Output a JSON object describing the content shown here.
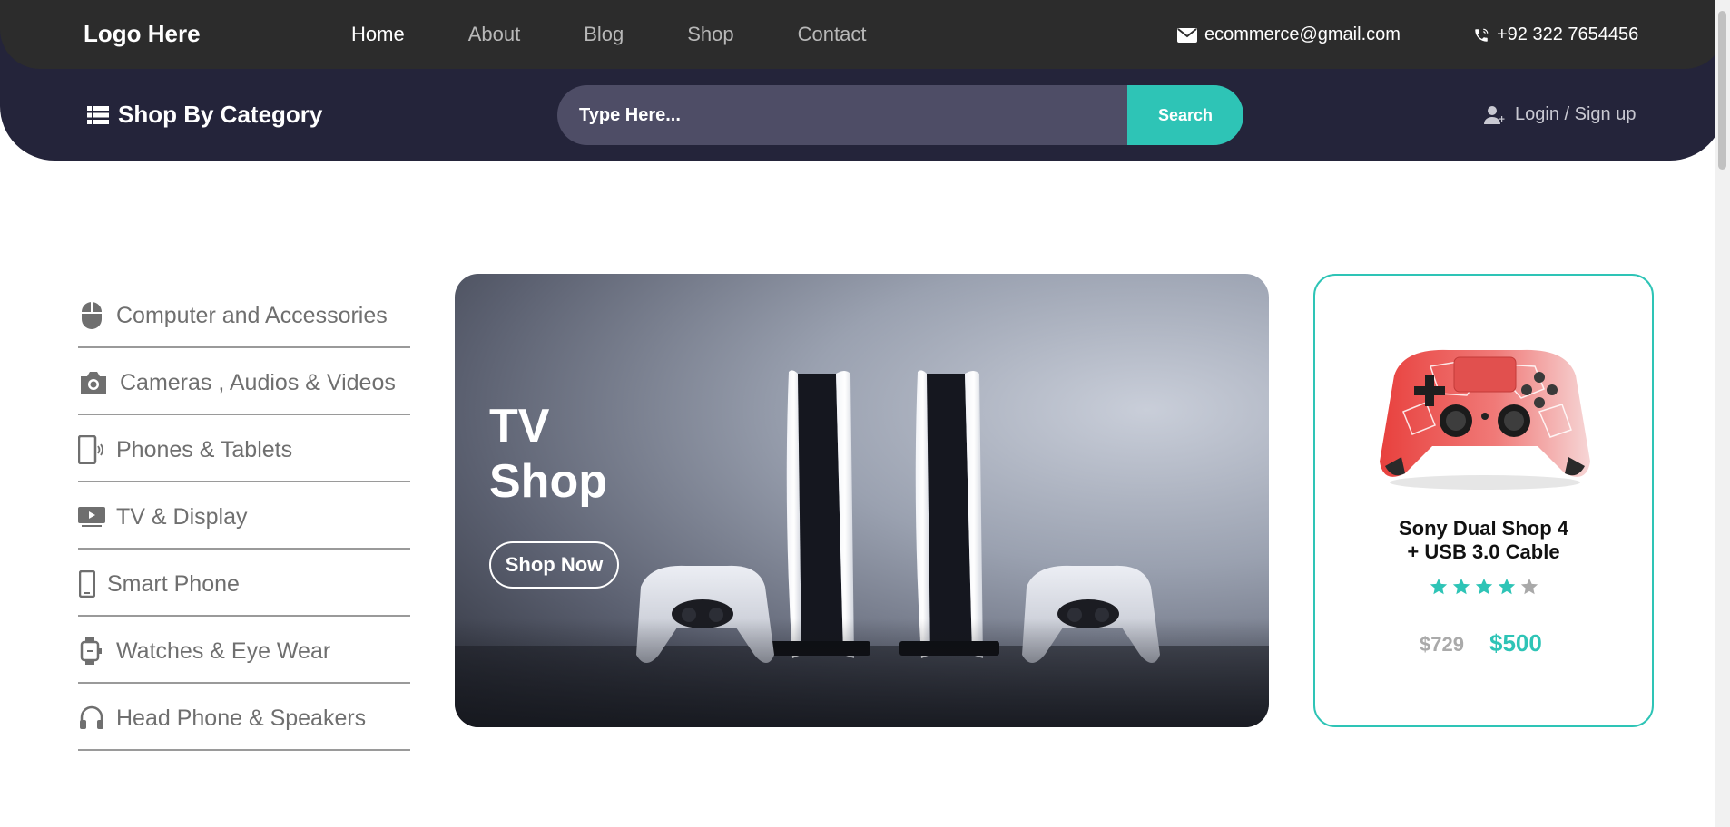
{
  "header": {
    "logo": "Logo Here",
    "nav": [
      {
        "label": "Home",
        "active": true
      },
      {
        "label": "About",
        "active": false
      },
      {
        "label": "Blog",
        "active": false
      },
      {
        "label": "Shop",
        "active": false
      },
      {
        "label": "Contact",
        "active": false
      }
    ],
    "email": "ecommerce@gmail.com",
    "phone": "+92 322 7654456",
    "category_label": "Shop By Category",
    "search": {
      "placeholder": "Type Here...",
      "button": "Search"
    },
    "login": "Login / Sign up"
  },
  "categories": [
    {
      "label": "Computer and Accessories",
      "icon": "mouse-icon"
    },
    {
      "label": "Cameras , Audios & Videos",
      "icon": "camera-icon"
    },
    {
      "label": "Phones & Tablets",
      "icon": "phone-tablet-icon"
    },
    {
      "label": "TV & Display",
      "icon": "tv-icon"
    },
    {
      "label": "Smart Phone",
      "icon": "smartphone-icon"
    },
    {
      "label": "Watches & Eye Wear",
      "icon": "watch-icon"
    },
    {
      "label": "Head Phone & Speakers",
      "icon": "headphones-icon"
    }
  ],
  "hero": {
    "title_line1": "TV",
    "title_line2": "Shop",
    "button": "Shop Now"
  },
  "product": {
    "title_line1": "Sony Dual Shop 4",
    "title_line2": "+ USB 3.0 Cable",
    "rating": 4,
    "rating_max": 5,
    "old_price": "$729",
    "new_price": "$500"
  },
  "colors": {
    "accent": "#2ec4b6",
    "header_dark": "#24243a",
    "topbar": "#2c2c2c"
  }
}
